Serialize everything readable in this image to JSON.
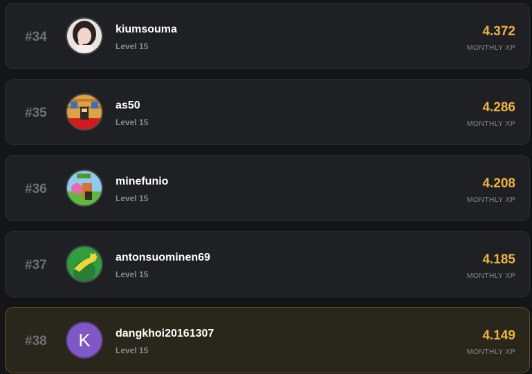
{
  "entries": [
    {
      "rank": "#34",
      "username": "kiumsouma",
      "level": "Level 15",
      "xp": "4.372",
      "xp_label": "MONTHLY XP",
      "avatar": "photo-avatar"
    },
    {
      "rank": "#35",
      "username": "as50",
      "level": "Level 15",
      "xp": "4.286",
      "xp_label": "MONTHLY XP",
      "avatar": "pixel-art-avatar"
    },
    {
      "rank": "#36",
      "username": "minefunio",
      "level": "Level 15",
      "xp": "4.208",
      "xp_label": "MONTHLY XP",
      "avatar": "cartoon-avatar"
    },
    {
      "rank": "#37",
      "username": "antonsuominen69",
      "level": "Level 15",
      "xp": "4.185",
      "xp_label": "MONTHLY XP",
      "avatar": "green-cat-avatar"
    },
    {
      "rank": "#38",
      "username": "dangkhoi20161307",
      "level": "Level 15",
      "xp": "4.149",
      "xp_label": "MONTHLY XP",
      "avatar": "letter-avatar",
      "avatar_letter": "K",
      "highlighted": true
    }
  ],
  "colors": {
    "background": "#141517",
    "card": "#1f2023",
    "highlight_card": "#29261b",
    "xp": "#f2b33d",
    "letter_avatar": "#7f57c6"
  }
}
